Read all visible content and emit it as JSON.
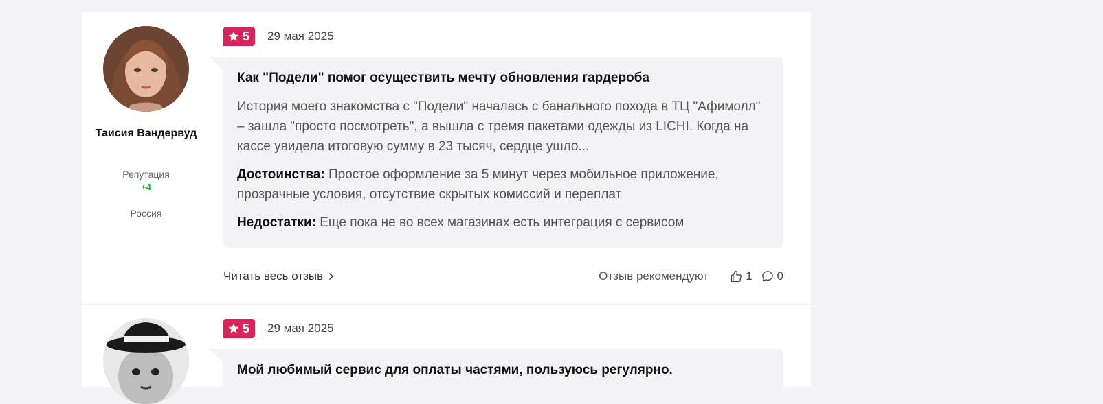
{
  "reviews": [
    {
      "author": {
        "name": "Таисия Вандервуд",
        "reputation_label": "Репутация",
        "reputation_value": "+4",
        "country": "Россия"
      },
      "rating": "5",
      "date": "29 мая 2025",
      "title": "Как \"Подели\" помог осуществить мечту обновления гардероба",
      "text": "История моего знакомства с \"Подели\" началась с банального похода в ТЦ \"Афимолл\" – зашла \"просто посмотреть\", а вышла с тремя пакетами одежды из LICHI. Когда на кассе увидела итоговую сумму в 23 тысяч, сердце ушло...",
      "pros_label": "Достоинства:",
      "pros": "Простое оформление за 5 минут через мобильное приложение, прозрачные условия, отсутствие скрытых комиссий и переплат",
      "cons_label": "Недостатки:",
      "cons": "Еще пока не во всех магазинах есть интеграция с сервисом",
      "read_more": "Читать весь отзыв",
      "recommend_label": "Отзыв рекомендуют",
      "likes": "1",
      "comments": "0"
    },
    {
      "rating": "5",
      "date": "29 мая 2025",
      "title": "Мой любимый сервис для оплаты частями, пользуюсь регулярно."
    }
  ],
  "colors": {
    "accent": "#d6245c",
    "reputation": "#1e9e3a",
    "bubble_bg": "#f3f3f6"
  },
  "icons": {
    "rating": "star-icon",
    "read_more": "chevron-right-icon",
    "likes": "thumb-up-icon",
    "comments": "comment-icon"
  }
}
